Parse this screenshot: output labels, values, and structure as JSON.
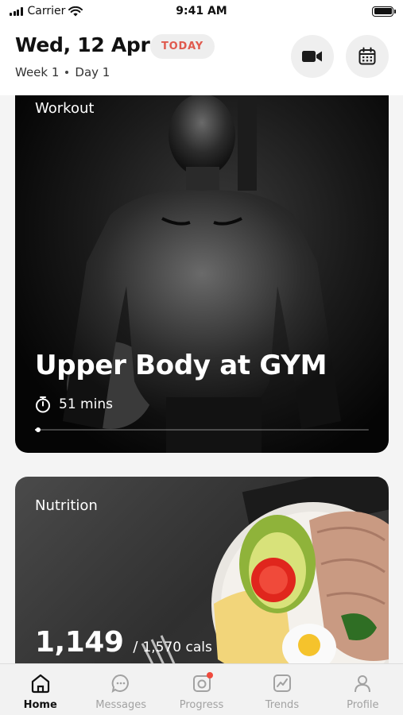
{
  "status_bar": {
    "carrier": "Carrier",
    "time": "9:41 AM"
  },
  "header": {
    "date": "Wed, 12 Apr",
    "badge": "TODAY",
    "week": "Week 1",
    "day": "Day 1",
    "video_icon": "video-camera-icon",
    "calendar_icon": "calendar-icon"
  },
  "workout": {
    "kicker": "Workout",
    "title": "Upper Body at GYM",
    "duration": "51 mins",
    "progress": 0.01,
    "image": "muscular man with tattoos in dark gym"
  },
  "nutrition": {
    "kicker": "Nutrition",
    "calories": "1,149",
    "separator": "/",
    "target": "1,570 cals",
    "image": "plate with avocado, tomato, egg, sliced chicken and cheese on dark stone"
  },
  "tabs": [
    {
      "label": "Home",
      "icon": "home-icon",
      "active": true
    },
    {
      "label": "Messages",
      "icon": "chat-icon",
      "active": false
    },
    {
      "label": "Progress",
      "icon": "camera-progress-icon",
      "active": false,
      "notification": true
    },
    {
      "label": "Trends",
      "icon": "trends-chart-icon",
      "active": false
    },
    {
      "label": "Profile",
      "icon": "person-icon",
      "active": false
    }
  ],
  "colors": {
    "accent": "#e05a4e",
    "notification": "#ef4a3d",
    "active_tab": "#111111",
    "inactive_tab": "#a2a2a2"
  }
}
